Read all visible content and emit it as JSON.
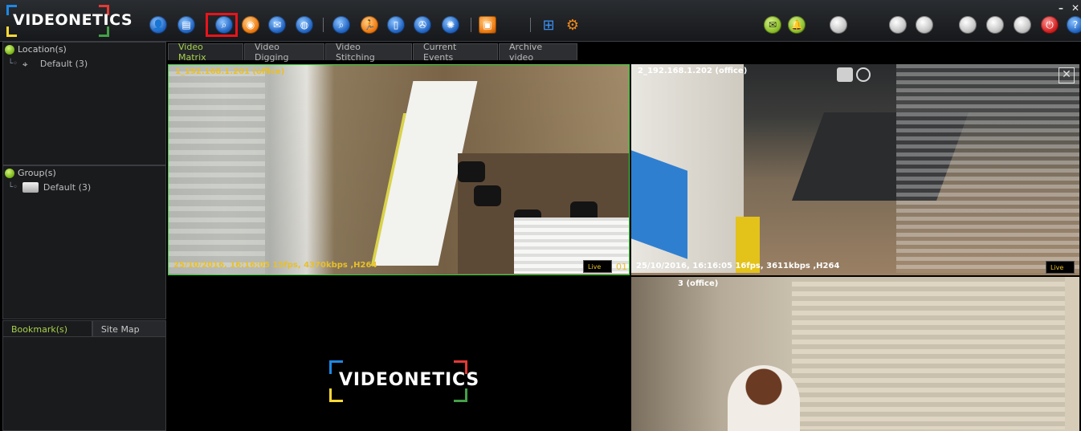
{
  "app": {
    "logo_text": "VIDEONETICS",
    "window_controls": {
      "minimize": "–",
      "close": "✕"
    }
  },
  "toolbar": {
    "icons": [
      {
        "name": "user-icon",
        "color": "blue",
        "glyph": "👤"
      },
      {
        "name": "recorder-icon",
        "color": "blue",
        "glyph": "▤"
      },
      {
        "name": "search-camera-icon",
        "color": "blue",
        "glyph": "⌕",
        "highlighted": true
      },
      {
        "name": "snapshot-icon",
        "color": "orange",
        "glyph": "◉"
      },
      {
        "name": "mail-icon",
        "color": "blue",
        "glyph": "✉"
      },
      {
        "name": "globe-icon",
        "color": "blue",
        "glyph": "◍"
      },
      {
        "name": "magnifier-icon",
        "color": "blue",
        "glyph": "⌕"
      },
      {
        "name": "running-person-icon",
        "color": "orange",
        "glyph": "🏃"
      },
      {
        "name": "mobile-icon",
        "color": "blue",
        "glyph": "▯"
      },
      {
        "name": "film-reel-icon",
        "color": "blue",
        "glyph": "✇"
      },
      {
        "name": "network-icon",
        "color": "blue",
        "glyph": "✺"
      },
      {
        "name": "monitor-icon",
        "color": "orange",
        "glyph": "▣"
      },
      {
        "name": "grid-layout-icon",
        "color": "blue",
        "glyph": "⊞"
      },
      {
        "name": "settings-gear-icon",
        "color": "orange",
        "glyph": "⚙"
      }
    ],
    "right_icons": [
      {
        "name": "message-icon",
        "color": "green",
        "glyph": "✉"
      },
      {
        "name": "bell-icon",
        "color": "green",
        "glyph": "🔔"
      },
      {
        "name": "status-light-icon-1",
        "color": "grey",
        "glyph": ""
      },
      {
        "name": "status-light-icon-2",
        "color": "grey",
        "glyph": ""
      },
      {
        "name": "status-light-icon-3",
        "color": "grey",
        "glyph": ""
      },
      {
        "name": "status-light-icon-4",
        "color": "grey",
        "glyph": ""
      },
      {
        "name": "status-light-icon-5",
        "color": "grey",
        "glyph": ""
      },
      {
        "name": "status-light-icon-6",
        "color": "grey",
        "glyph": ""
      },
      {
        "name": "power-icon",
        "color": "red",
        "glyph": "⏻"
      },
      {
        "name": "help-icon",
        "color": "blue",
        "glyph": "?"
      }
    ]
  },
  "left_panel": {
    "location": {
      "header": "Location(s)",
      "items": [
        "Default (3)"
      ]
    },
    "group": {
      "header": "Group(s)",
      "items": [
        "Default (3)"
      ]
    },
    "bottom_tabs": [
      "Bookmark(s)",
      "Site Map"
    ]
  },
  "tabs": [
    "Video Matrix",
    "Video Digging",
    "Video Stitching",
    "Current Events",
    "Archive video"
  ],
  "active_tab": "Video Matrix",
  "tiles": [
    {
      "title": "1_192.168.1.201 (office)",
      "status": "25/10/2016, 16:16:05  15fps, 4370kbps ,H264",
      "live": "Live",
      "num": "01",
      "title_color": "#e8c02a",
      "status_color": "#e8c02a"
    },
    {
      "title": "2_192.168.1.202 (office)",
      "status": "25/10/2016, 16:16:05  16fps, 3611kbps ,H264",
      "live": "Live",
      "title_color": "#ffffff",
      "status_color": "#ffffff"
    },
    {
      "title": "3 (office)",
      "title_color": "#ffffff"
    }
  ],
  "center_logo": "VIDEONETICS",
  "colors": {
    "accent_green": "#a8d24a",
    "highlight_red": "#e8141b",
    "live_yellow": "#e8c02a"
  }
}
